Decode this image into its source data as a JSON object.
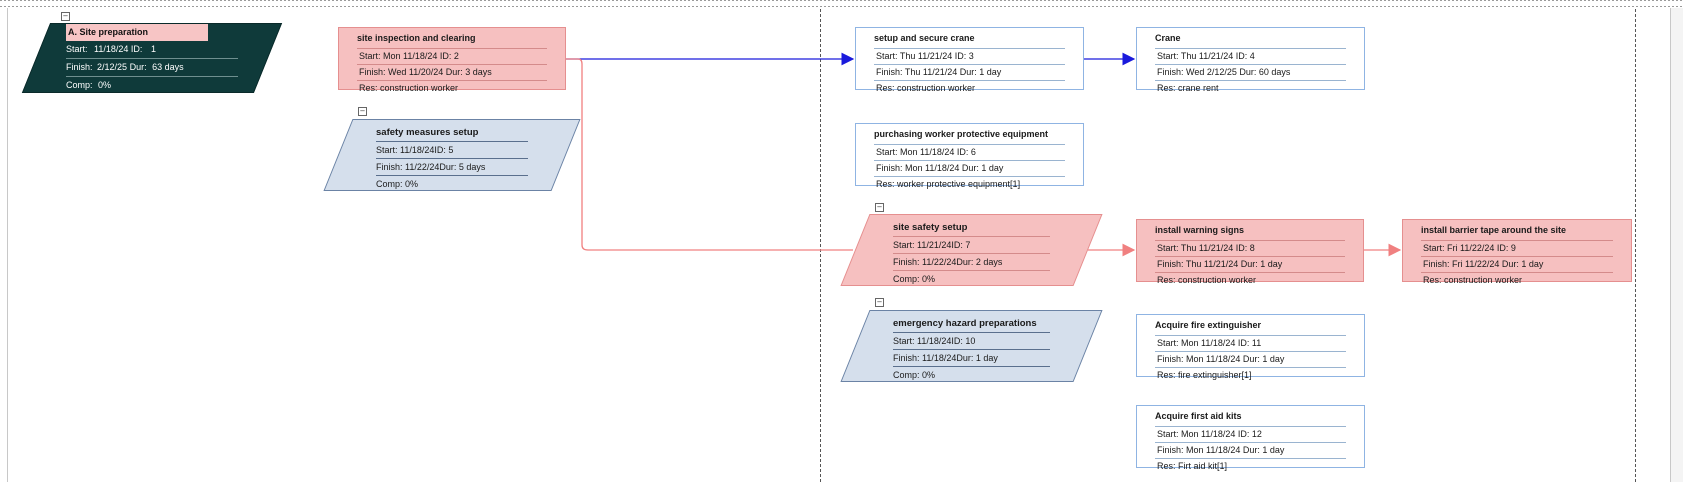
{
  "summary": {
    "title": "A. Site preparation",
    "start_label": "Start:",
    "start": "11/18/24",
    "id_label": "ID:",
    "id": "1",
    "finish_label": "Finish:",
    "finish": "2/12/25",
    "dur_label": "Dur:",
    "dur": "63 days",
    "comp_label": "Comp:",
    "comp": "0%"
  },
  "tasks": {
    "t2": {
      "title": "site inspection and clearing",
      "start": "Start:  Mon 11/18/24   ID:   2",
      "finish": "Finish: Wed 11/20/24 Dur: 3 days",
      "res": "Res:    construction worker"
    },
    "t3": {
      "title": "setup and secure crane",
      "start": "Start:  Thu 11/21/24    ID:   3",
      "finish": "Finish: Thu 11/21/24  Dur: 1 day",
      "res": "Res:    construction worker"
    },
    "t4": {
      "title": "Crane",
      "start": "Start:  Thu 11/21/24    ID:   4",
      "finish": "Finish: Wed 2/12/25   Dur: 60 days",
      "res": "Res:    crane rent"
    },
    "t6": {
      "title": "purchasing worker protective equipment",
      "start": "Start:  Mon 11/18/24   ID:   6",
      "finish": "Finish: Mon 11/18/24 Dur: 1 day",
      "res": "Res:    worker protective equipment[1]"
    },
    "t8": {
      "title": "install warning signs",
      "start": "Start:  Thu 11/21/24    ID:   8",
      "finish": "Finish: Thu 11/21/24  Dur: 1 day",
      "res": "Res:    construction worker"
    },
    "t9": {
      "title": "install barrier tape around the site",
      "start": "Start:  Fri 11/22/24     ID:   9",
      "finish": "Finish: Fri 11/22/24    Dur: 1 day",
      "res": "Res:    construction worker"
    },
    "t11": {
      "title": "Acquire fire extinguisher",
      "start": "Start:  Mon 11/18/24   ID:   11",
      "finish": "Finish: Mon 11/18/24 Dur: 1 day",
      "res": "Res:    fire extinguisher[1]"
    },
    "t12": {
      "title": "Acquire first aid kits",
      "start": "Start:  Mon 11/18/24   ID:   12",
      "finish": "Finish: Mon 11/18/24 Dur: 1 day",
      "res": "Res:    Firt aid kit[1]"
    }
  },
  "groups": {
    "g5": {
      "title": "safety measures setup",
      "start": "Start:  11/18/24",
      "id": "ID:     5",
      "finish": "Finish: 11/22/24",
      "dur": "Dur: 5 days",
      "comp": "Comp: 0%"
    },
    "g7": {
      "title": "site safety setup",
      "start": "Start:  11/21/24",
      "id": "ID:     7",
      "finish": "Finish: 11/22/24",
      "dur": "Dur: 2 days",
      "comp": "Comp: 0%"
    },
    "g10": {
      "title": "emergency hazard  preparations",
      "start": "Start:  11/18/24",
      "id": "ID:     10",
      "finish": "Finish: 11/18/24",
      "dur": "Dur: 1 day",
      "comp": "Comp: 0%"
    }
  },
  "colors": {
    "critical_fill": "#f6c0c0",
    "critical_link": "#f08080",
    "normal_link": "#1a1adc",
    "summary_fill": "#0f3a3a",
    "group_fill": "#d5dfec"
  },
  "icons": {
    "collapse": "−"
  }
}
